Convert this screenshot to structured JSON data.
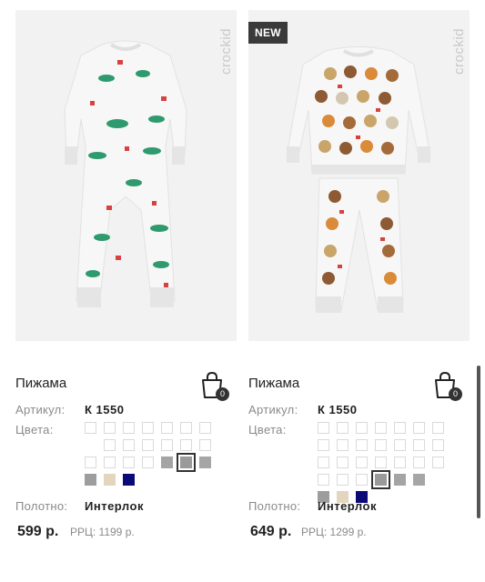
{
  "products": [
    {
      "title": "Пижама",
      "badge": "",
      "brand": "crockid",
      "article_label": "Артикул:",
      "article_value": "К 1550",
      "colors_label": "Цвета:",
      "fabric_label": "Полотно:",
      "fabric_value": "Интерлок",
      "price": "599 р.",
      "rrp": "РРЦ: 1199 р.",
      "cart_count": "0",
      "swatches": [
        "#ffffff",
        "#ffffff",
        "#ffffff",
        "#ffffff",
        "#ffffff",
        "#ffffff",
        "#ffffff",
        "hidden",
        "#ffffff",
        "#ffffff",
        "#ffffff",
        "#ffffff",
        "#ffffff",
        "#ffffff",
        "#ffffff",
        "#ffffff",
        "#ffffff",
        "#ffffff",
        "#a4a4a4",
        "sel:#9a9a9a",
        "#a6a6a6",
        "#9d9d9d",
        "#e3d6bf",
        "#0b0b78",
        "hidden",
        "hidden",
        "hidden",
        "hidden"
      ]
    },
    {
      "title": "Пижама",
      "badge": "NEW",
      "brand": "crockid",
      "article_label": "Артикул:",
      "article_value": "К 1550",
      "colors_label": "Цвета:",
      "fabric_label": "Полотно:",
      "fabric_value": "Интерлок",
      "price": "649 р.",
      "rrp": "РРЦ: 1299 р.",
      "cart_count": "0",
      "swatches": [
        "#ffffff",
        "#ffffff",
        "#ffffff",
        "#ffffff",
        "#ffffff",
        "#ffffff",
        "#ffffff",
        "#ffffff",
        "#ffffff",
        "#ffffff",
        "#ffffff",
        "#ffffff",
        "#ffffff",
        "#ffffff",
        "#ffffff",
        "#ffffff",
        "#ffffff",
        "#ffffff",
        "#ffffff",
        "#ffffff",
        "#ffffff",
        "#ffffff",
        "#ffffff",
        "#ffffff",
        "sel:#9a9a9a",
        "#a4a4a4",
        "#a6a6a6",
        "hidden",
        "#9d9d9d",
        "#e3d6bf",
        "#0b0b78",
        "hidden",
        "hidden",
        "hidden",
        "hidden"
      ]
    }
  ],
  "icons": {
    "cart": "shopping-bag-icon"
  }
}
